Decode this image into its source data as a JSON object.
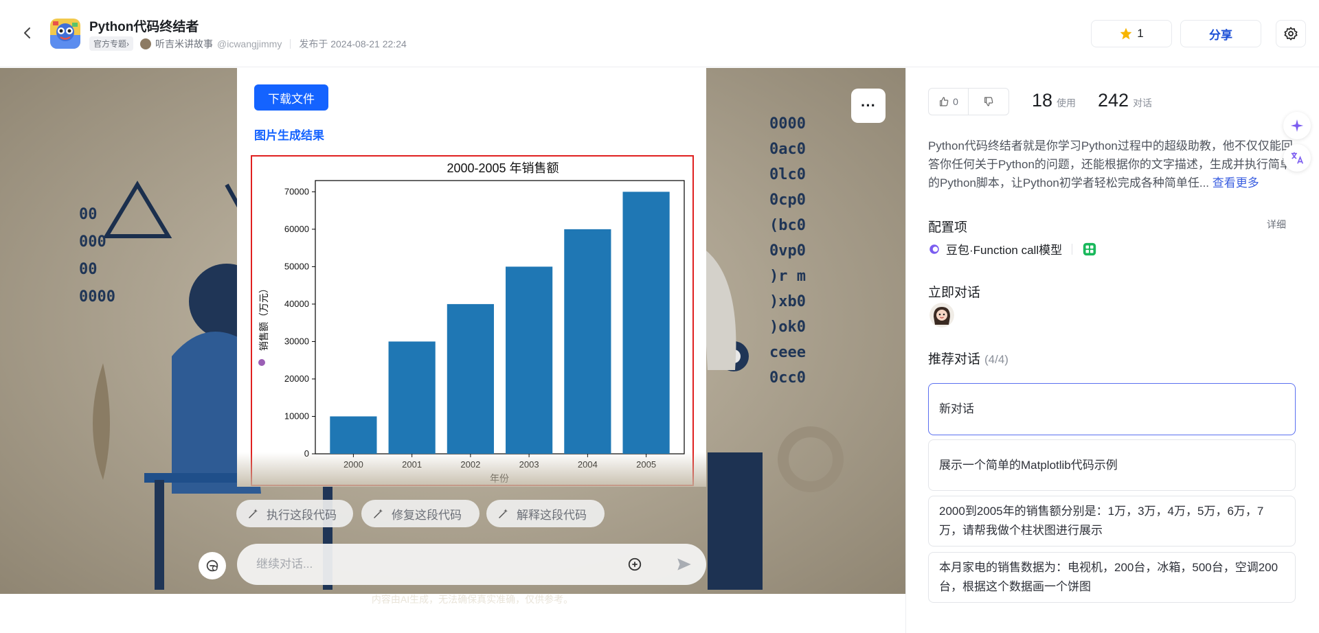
{
  "header": {
    "app_title": "Python代码终结者",
    "tag": "官方专题›",
    "author": "听吉米讲故事",
    "handle": "@icwangjimmy",
    "published": "发布于 2024-08-21 22:24",
    "star_count": "1",
    "share_label": "分享"
  },
  "chat": {
    "download_label": "下载文件",
    "result_title": "图片生成结果",
    "actions": [
      "执行这段代码",
      "修复这段代码",
      "解释这段代码"
    ],
    "input_placeholder": "继续对话...",
    "disclaimer": "内容由AI生成，无法确保真实准确，仅供参考。"
  },
  "chart_data": {
    "type": "bar",
    "title": "2000-2005 年销售额",
    "xlabel": "年份",
    "ylabel": "销售额（万元）",
    "categories": [
      "2000",
      "2001",
      "2002",
      "2003",
      "2004",
      "2005"
    ],
    "values": [
      10000,
      30000,
      40000,
      50000,
      60000,
      70000
    ],
    "ylim": [
      0,
      73000
    ],
    "yticks": [
      0,
      10000,
      20000,
      30000,
      40000,
      50000,
      60000,
      70000
    ],
    "bar_color": "#1f77b4",
    "grid": false
  },
  "sidebar": {
    "likes": "0",
    "uses_num": "18",
    "uses_label": "使用",
    "convs_num": "242",
    "convs_label": "对话",
    "description": "Python代码终结者就是你学习Python过程中的超级助教，他不仅仅能回答你任何关于Python的问题，还能根据你的文字描述，生成并执行简单的Python脚本，让Python初学者轻松完成各种简单任...",
    "see_more": "查看更多",
    "config_title": "配置项",
    "detail_label": "详细",
    "model_name": "豆包·Function call模型",
    "start_title": "立即对话",
    "rec_title": "推荐对话",
    "rec_count": "(4/4)",
    "rec_items": [
      "新对话",
      "展示一个简单的Matplotlib代码示例",
      "2000到2005年的销售额分别是：1万，3万，4万，5万，6万，7万，请帮我做个柱状图进行展示",
      "本月家电的销售数据为：电视机，200台，冰箱，500台，空调200台，根据这个数据画一个饼图"
    ]
  },
  "colors": {
    "accent": "#1463ff",
    "highlight_border": "#e0201f",
    "share_text": "#1c4fd6"
  }
}
